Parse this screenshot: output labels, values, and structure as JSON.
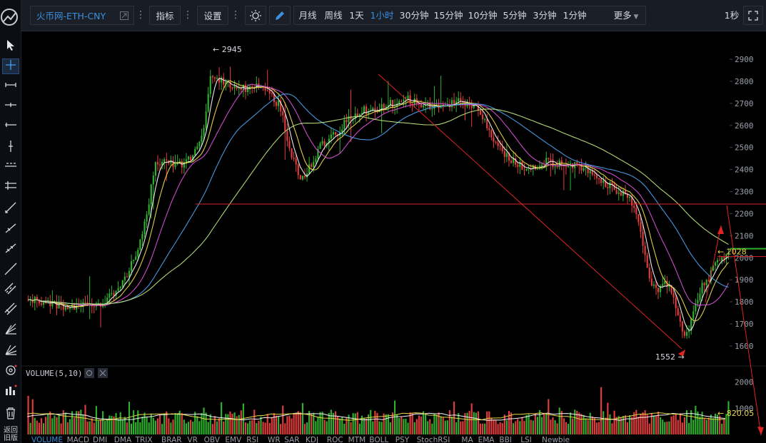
{
  "toolbar": {
    "symbol": "火币网-ETH-CNY",
    "indicators": "指标",
    "settings": "设置",
    "periods": [
      "月线",
      "周线",
      "1天",
      "1小时",
      "30分钟",
      "15分钟",
      "10分钟",
      "5分钟",
      "3分钟",
      "1分钟"
    ],
    "active_period": "1小时",
    "more": "更多",
    "refresh": "1秒"
  },
  "left_tools": {
    "bottom_label_1": "返回",
    "bottom_label_2": "旧版"
  },
  "volume_panel": {
    "title": "VOLUME(5,10)",
    "last_value": "820.05"
  },
  "price_annotations": {
    "high": "2945",
    "low": "1552",
    "last": "2028"
  },
  "bottom_tabs": [
    "VOLUME",
    "MACD",
    "DMI",
    "DMA",
    "TRIX",
    "BRAR",
    "VR",
    "OBV",
    "EMV",
    "RSI",
    "WR",
    "SAR",
    "KDJ",
    "ROC",
    "MTM",
    "BOLL",
    "PSY",
    "StochRSI",
    "MA",
    "EMA",
    "BBI",
    "LSI",
    "Newbie"
  ],
  "colors": {
    "up": "#2fb12f",
    "down": "#e23d3d",
    "ma1": "#f5f5f5",
    "ma2": "#e8d84a",
    "ma3": "#d64fd6",
    "ma4": "#4a9ee8",
    "ma5": "#b9e07a",
    "accent": "#3a8fe0",
    "drawing": "#e02424"
  },
  "chart_data": [
    {
      "type": "candlestick",
      "title": "火币网-ETH-CNY",
      "y_ticks": [
        2900,
        2800,
        2700,
        2600,
        2500,
        2400,
        2300,
        2200,
        2100,
        2000,
        1900,
        1800,
        1700,
        1600
      ],
      "ylim": [
        1520,
        3000
      ],
      "annotations": [
        {
          "label": "2945",
          "value": 2945
        },
        {
          "label": "1552",
          "value": 1552
        },
        {
          "label": "2028",
          "value": 2028
        }
      ],
      "ma_series": [
        "MA1",
        "MA2",
        "MA3",
        "MA4",
        "MA5"
      ],
      "price_path": [
        [
          0,
          1810
        ],
        [
          0.03,
          1790
        ],
        [
          0.06,
          1780
        ],
        [
          0.09,
          1790
        ],
        [
          0.11,
          1800
        ],
        [
          0.13,
          1870
        ],
        [
          0.15,
          1980
        ],
        [
          0.17,
          2200
        ],
        [
          0.18,
          2420
        ],
        [
          0.2,
          2450
        ],
        [
          0.21,
          2420
        ],
        [
          0.23,
          2440
        ],
        [
          0.25,
          2560
        ],
        [
          0.26,
          2810
        ],
        [
          0.28,
          2800
        ],
        [
          0.3,
          2760
        ],
        [
          0.32,
          2780
        ],
        [
          0.34,
          2750
        ],
        [
          0.36,
          2690
        ],
        [
          0.37,
          2540
        ],
        [
          0.38,
          2430
        ],
        [
          0.39,
          2350
        ],
        [
          0.4,
          2400
        ],
        [
          0.42,
          2520
        ],
        [
          0.44,
          2560
        ],
        [
          0.46,
          2640
        ],
        [
          0.48,
          2670
        ],
        [
          0.5,
          2680
        ],
        [
          0.52,
          2700
        ],
        [
          0.54,
          2720
        ],
        [
          0.56,
          2690
        ],
        [
          0.58,
          2690
        ],
        [
          0.6,
          2700
        ],
        [
          0.62,
          2710
        ],
        [
          0.64,
          2680
        ],
        [
          0.66,
          2560
        ],
        [
          0.68,
          2470
        ],
        [
          0.7,
          2420
        ],
        [
          0.72,
          2410
        ],
        [
          0.74,
          2440
        ],
        [
          0.76,
          2420
        ],
        [
          0.78,
          2420
        ],
        [
          0.8,
          2400
        ],
        [
          0.82,
          2340
        ],
        [
          0.84,
          2310
        ],
        [
          0.86,
          2260
        ],
        [
          0.87,
          2200
        ],
        [
          0.88,
          2020
        ],
        [
          0.89,
          1880
        ],
        [
          0.9,
          1850
        ],
        [
          0.91,
          1900
        ],
        [
          0.92,
          1820
        ],
        [
          0.93,
          1700
        ],
        [
          0.94,
          1640
        ],
        [
          0.95,
          1760
        ],
        [
          0.96,
          1860
        ],
        [
          0.97,
          1900
        ],
        [
          0.98,
          1960
        ],
        [
          1.0,
          2028
        ]
      ]
    },
    {
      "type": "bar",
      "title": "VOLUME(5,10)",
      "y_ticks": [
        2000,
        1000
      ],
      "ylim": [
        0,
        2200
      ],
      "last_value": 820.05
    }
  ]
}
